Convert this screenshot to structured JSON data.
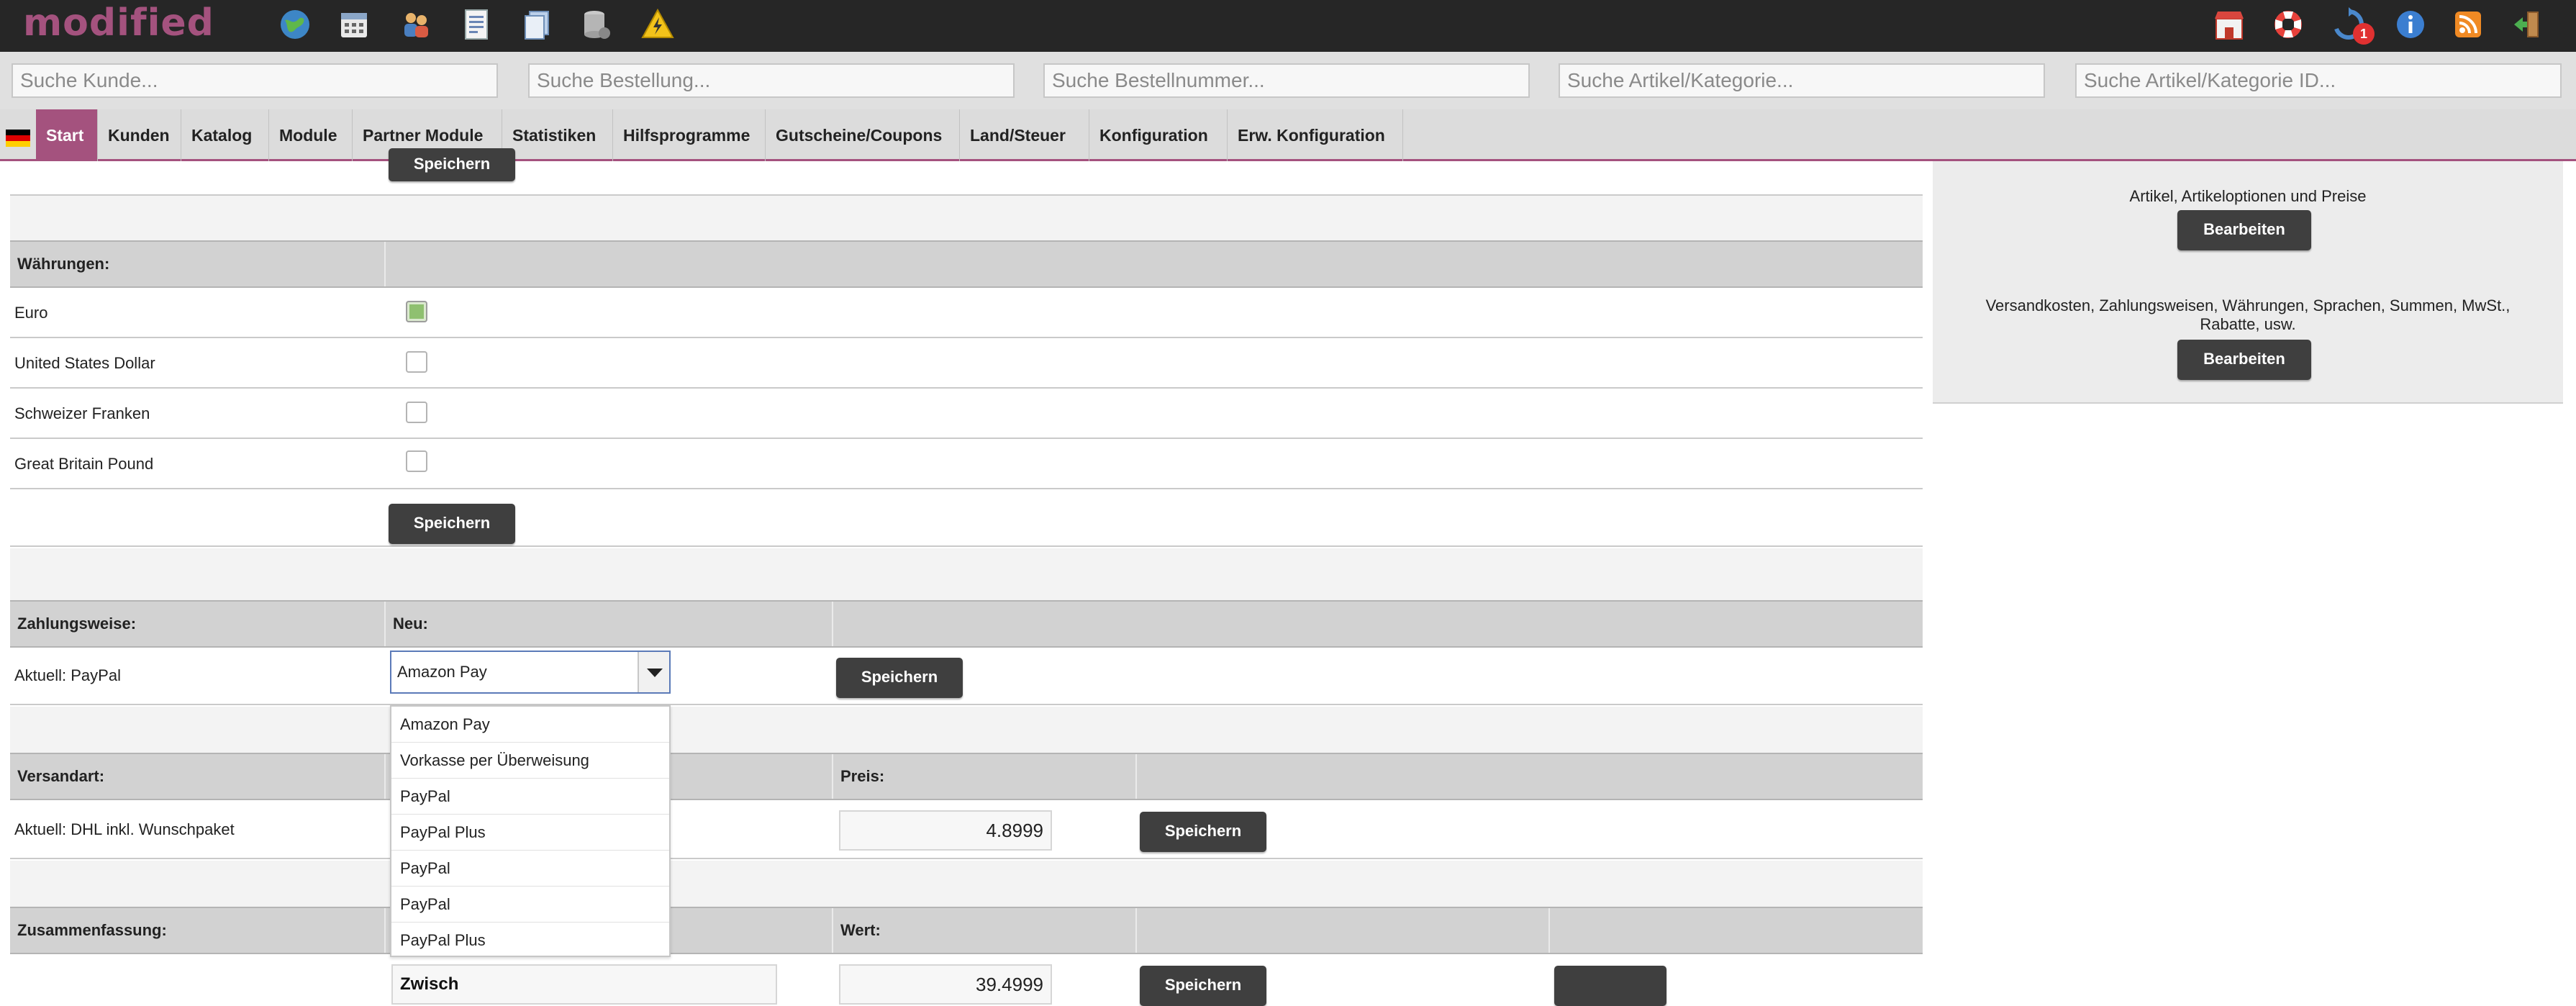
{
  "app": {
    "logo_text": "modified",
    "brand_color": "#a4527e",
    "header_bg": "#262626"
  },
  "toolbar_icons_left": [
    "globe-icon",
    "calendar-icon",
    "users-icon",
    "invoice-icon",
    "documents-icon",
    "database-icon",
    "warning-icon"
  ],
  "toolbar_icons_right": [
    "shop-icon",
    "lifebuoy-icon",
    "refresh-icon",
    "info-icon",
    "rss-icon",
    "logout-icon"
  ],
  "notification_badge": "1",
  "search": {
    "customer_placeholder": "Suche Kunde...",
    "order_placeholder": "Suche Bestellung...",
    "order_number_placeholder": "Suche Bestellnummer...",
    "article_placeholder": "Suche Artikel/Kategorie...",
    "article_id_placeholder": "Suche Artikel/Kategorie ID..."
  },
  "nav": {
    "flag": "german-flag-icon",
    "tabs": [
      "Start",
      "Kunden",
      "Katalog",
      "Module",
      "Partner Module",
      "Statistiken",
      "Hilfsprogramme",
      "Gutscheine/Coupons",
      "Land/Steuer",
      "Konfiguration",
      "Erw. Konfiguration"
    ],
    "active": "Start"
  },
  "buttons": {
    "save": "Speichern",
    "edit": "Bearbeiten"
  },
  "currencies": {
    "header": "Währungen:",
    "items": [
      {
        "label": "Euro",
        "checked": true
      },
      {
        "label": "United States Dollar",
        "checked": false
      },
      {
        "label": "Schweizer Franken",
        "checked": false
      },
      {
        "label": "Great Britain Pound",
        "checked": false
      }
    ]
  },
  "payment": {
    "header": "Zahlungsweise:",
    "new_header": "Neu:",
    "current": "Aktuell: PayPal",
    "selected": "Amazon Pay",
    "options": [
      "Amazon Pay",
      "Vorkasse per Überweisung",
      "PayPal",
      "PayPal Plus",
      "PayPal",
      "PayPal",
      "PayPal Plus"
    ]
  },
  "shipping": {
    "header": "Versandart:",
    "price_header": "Preis:",
    "current": "Aktuell: DHL inkl. Wunschpaket",
    "price": "4.8999"
  },
  "summary": {
    "header": "Zusammenfassung:",
    "value_header": "Wert:",
    "partial_input": "Zwisch",
    "partial_value": "39.4999"
  },
  "right_panel": {
    "section1": "Artikel, Artikeloptionen und Preise",
    "section2": "Versandkosten, Zahlungsweisen, Währungen, Sprachen, Summen, MwSt., Rabatte, usw."
  }
}
